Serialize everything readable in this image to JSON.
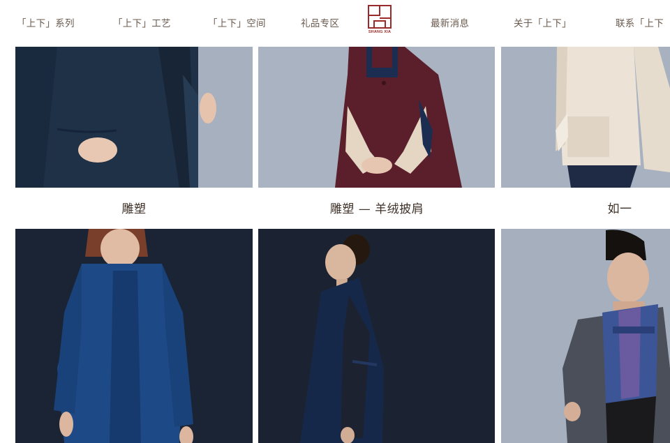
{
  "nav": {
    "left": [
      "「上下」系列",
      "「上下」工艺",
      "「上下」空间",
      "礼品专区"
    ],
    "right": [
      "最新消息",
      "关于「上下」",
      "联系「上下"
    ],
    "logo_text": "SHANG XIA"
  },
  "products": {
    "row1": [
      {
        "caption": "雕塑"
      },
      {
        "caption": "雕塑 — 羊绒披肩"
      },
      {
        "caption": "如一"
      }
    ]
  },
  "colors": {
    "brand_red": "#9a2a2a",
    "nav_text": "#6b5a4e",
    "caption_text": "#3f3128"
  }
}
